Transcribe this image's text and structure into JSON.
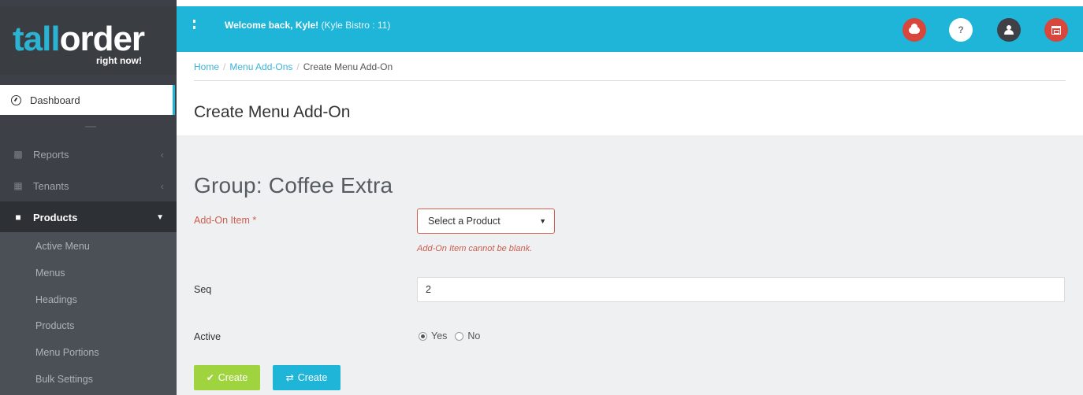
{
  "logo": {
    "word_part1": "tall",
    "word_part2": "order",
    "tagline": "right now!"
  },
  "sidebar": {
    "dashboard": "Dashboard",
    "items": [
      {
        "label": "Reports",
        "icon": "bar-chart-icon"
      },
      {
        "label": "Tenants",
        "icon": "building-icon"
      },
      {
        "label": "Products",
        "icon": "bag-icon"
      }
    ],
    "products_sub": [
      "Active Menu",
      "Menus",
      "Headings",
      "Products",
      "Menu Portions",
      "Bulk Settings"
    ]
  },
  "topbar": {
    "welcome": "Welcome back, Kyle!",
    "bistro": "(Kyle Bistro : 11)",
    "icons": [
      "cloud-upload-icon",
      "help-icon",
      "user-icon",
      "store-icon"
    ]
  },
  "breadcrumb": {
    "home": "Home",
    "menu_addons": "Menu Add-Ons",
    "current": "Create Menu Add-On"
  },
  "page_title": "Create Menu Add-On",
  "form": {
    "group_title": "Group: Coffee Extra",
    "addon_label": "Add-On Item",
    "addon_required": "*",
    "addon_select": "Select a Product",
    "addon_error": "Add-On Item cannot be blank.",
    "seq_label": "Seq",
    "seq_value": "2",
    "active_label": "Active",
    "active_yes": "Yes",
    "active_no": "No",
    "create_btn": "Create",
    "create_btn2": "Create"
  },
  "colors": {
    "accent": "#1fb5d9",
    "success": "#9fd43f",
    "danger": "#d05d4f",
    "sidebar": "#3d4046"
  }
}
